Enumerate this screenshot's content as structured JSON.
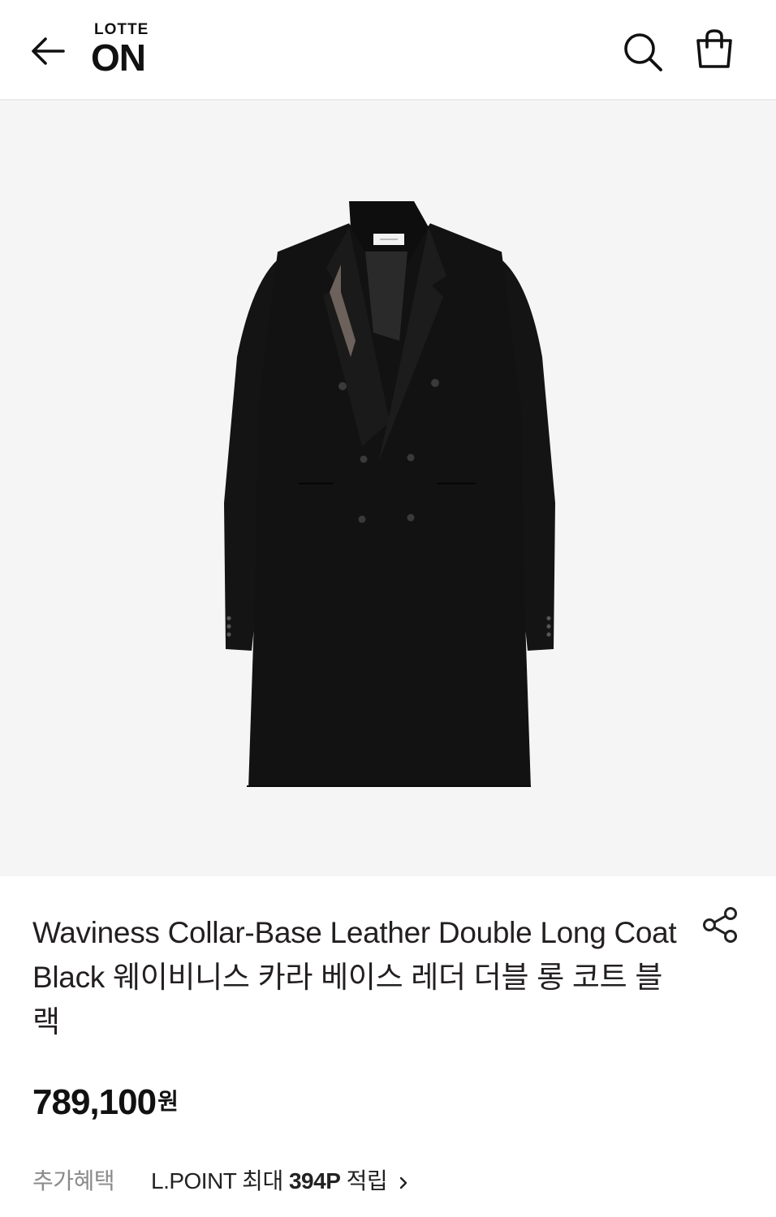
{
  "header": {
    "logo_top": "LOTTE",
    "logo_main": "ON",
    "icons": [
      "back-arrow-icon",
      "search-icon",
      "shopping-bag-icon"
    ]
  },
  "product": {
    "image_alt": "black double-breasted long coat",
    "title": "Waviness Collar-Base Leather Double Long Coat Black 웨이비니스 카라 베이스 레더 더블 롱 코트 블랙",
    "price": "789,100",
    "currency": "원",
    "share_icon": "share-icon"
  },
  "benefits": {
    "label": "추가혜택",
    "prefix": "L.POINT 최대 ",
    "points": "394P",
    "suffix": " 적립"
  },
  "colors": {
    "hero_bg": "#f5f5f5",
    "text": "#231f20",
    "muted": "#8a8a8a"
  }
}
